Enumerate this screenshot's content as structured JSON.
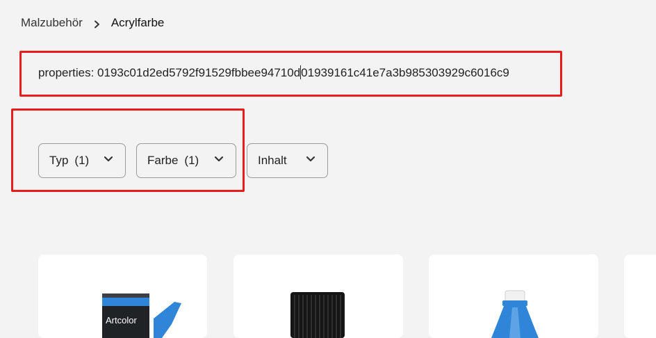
{
  "breadcrumb": {
    "parent": "Malzubehör",
    "current": "Acrylfarbe"
  },
  "properties_text": "properties: 0193c01d2ed5792f91529fbbee94710d|01939161c41e7a3b985303929c6016c9",
  "filters": [
    {
      "label": "Typ",
      "count": "(1)"
    },
    {
      "label": "Farbe",
      "count": "(1)"
    },
    {
      "label": "Inhalt",
      "count": ""
    }
  ],
  "products": [
    {
      "image": "paint-tube-image",
      "tube_text": "Artcolor"
    },
    {
      "image": "paint-bottle-black-cap-image"
    },
    {
      "image": "blue-bottle-white-cap-image"
    },
    {
      "image": "product-image"
    }
  ],
  "colors": {
    "background": "#f3f3f3",
    "card": "#ffffff",
    "highlight_border": "#e81c1c",
    "button_border": "#9a9a9a",
    "accent_blue": "#2f86d8"
  }
}
